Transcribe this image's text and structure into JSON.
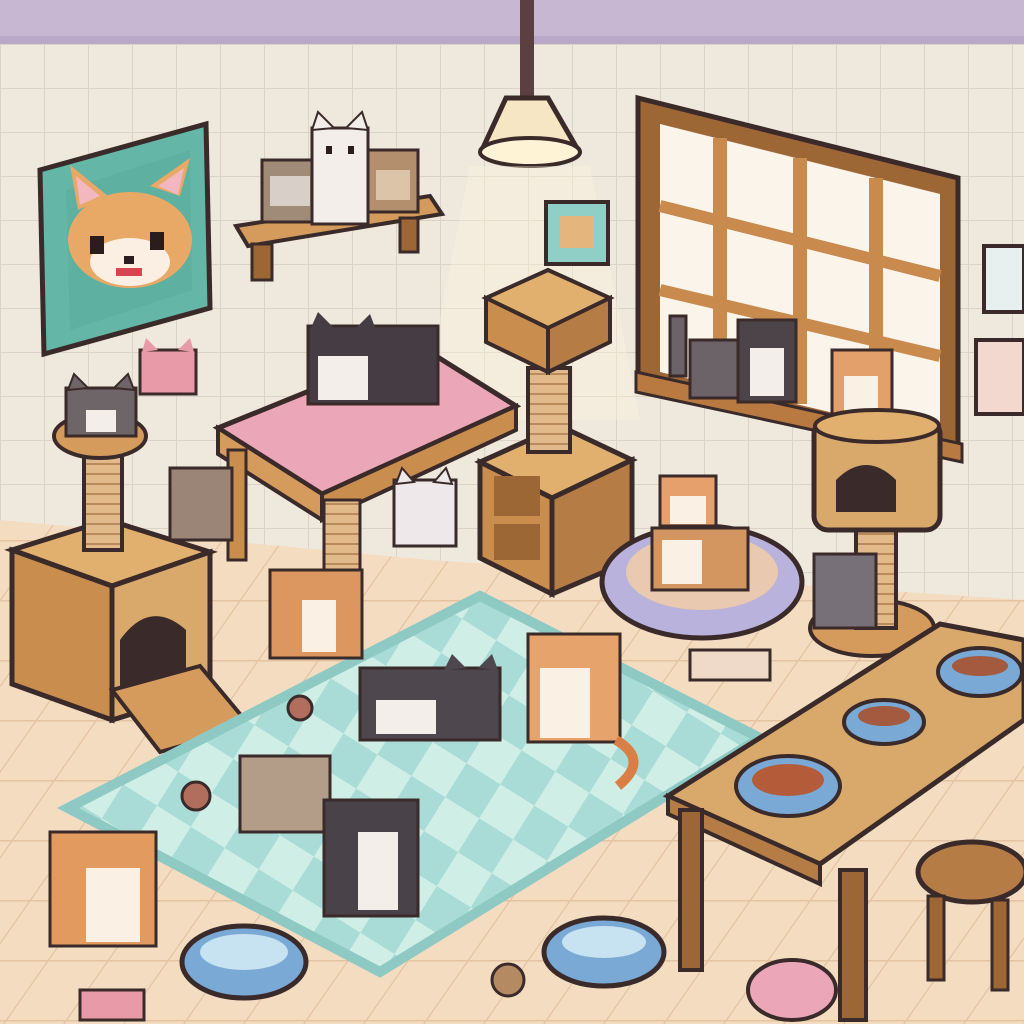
{
  "scene": {
    "kind": "isometric pixel-art cat cafe room",
    "palette": {
      "wall": "#efe8dc",
      "wall_top": "#b9a8c8",
      "floor": "#f3dcc0",
      "floor_line": "#e4c3a0",
      "rug_light": "#cfeee6",
      "rug_dark": "#a9dcd6",
      "wood": "#d49b5c",
      "wood_dark": "#9c6635",
      "cardboard": "#d9a86b",
      "rope": "#e2b98a",
      "cushion_pink": "#eba6b8",
      "bed_ring": "#b8b2dd",
      "bowl_blue": "#79a9d4",
      "outline": "#3a2a2a"
    },
    "cat_count": 18,
    "icons": [
      "cat-portrait-frame-icon",
      "ceiling-lamp-icon",
      "window-icon",
      "wall-shelf-icon",
      "cat-tree-icon",
      "cat-house-icon",
      "cat-bed-icon",
      "food-bowl-icon",
      "water-bowl-icon",
      "table-icon",
      "stool-icon",
      "fish-toy-icon",
      "yarn-ball-icon"
    ]
  }
}
